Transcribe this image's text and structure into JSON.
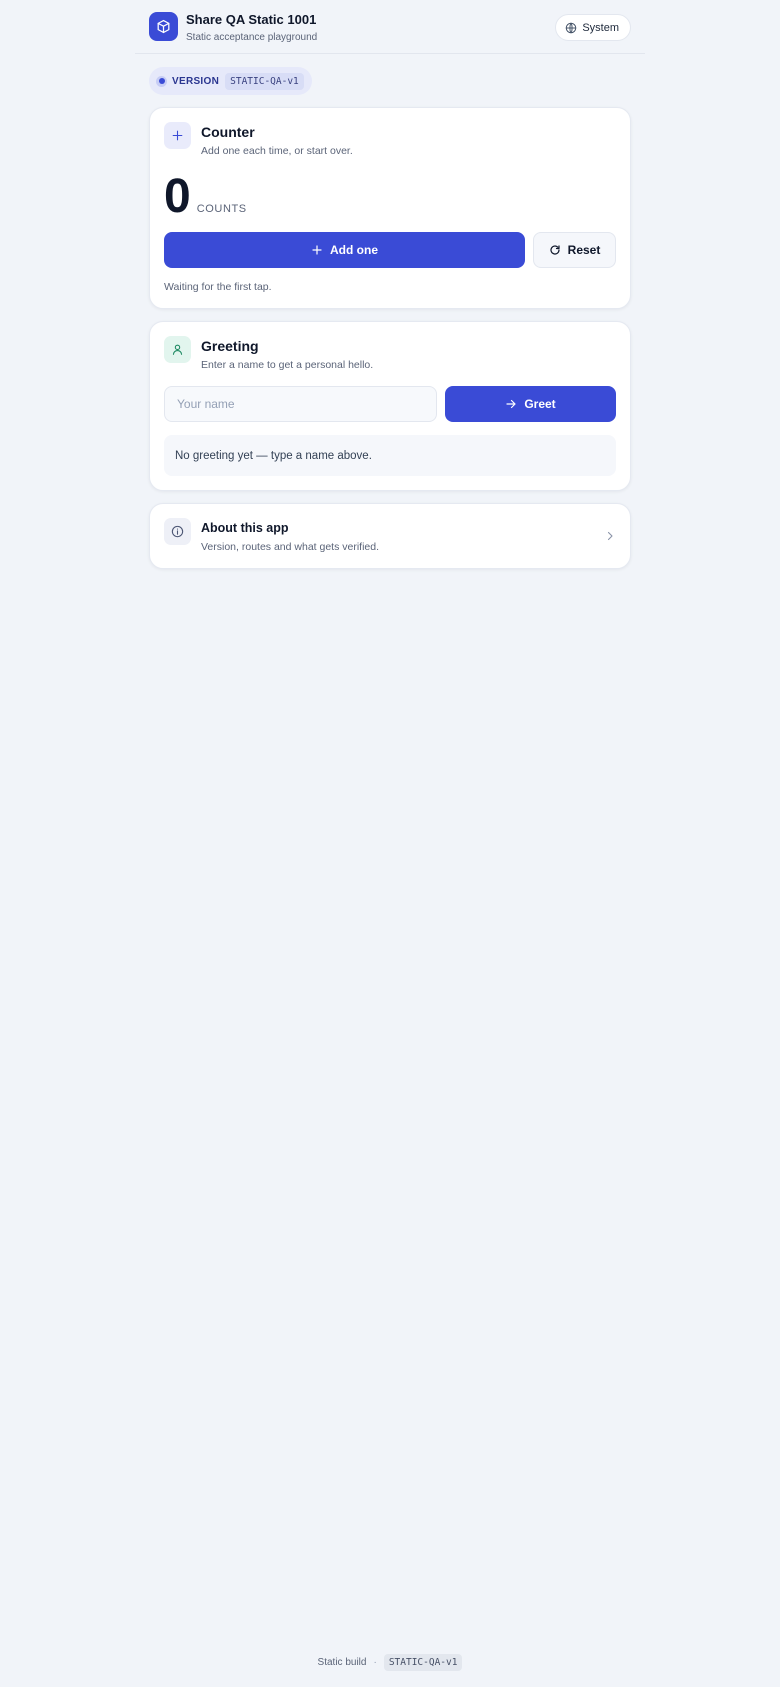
{
  "header": {
    "title": "Share QA Static 1001",
    "subtitle": "Static acceptance playground",
    "theme_button": "System",
    "brand_icon": "cube-icon",
    "theme_icon": "globe-icon"
  },
  "version": {
    "label": "VERSION",
    "code": "STATIC-QA-v1"
  },
  "counter": {
    "title": "Counter",
    "description": "Add one each time, or start over.",
    "value": "0",
    "unit": "COUNTS",
    "add_label": "Add one",
    "reset_label": "Reset",
    "status": "Waiting for the first tap."
  },
  "greeting": {
    "title": "Greeting",
    "description": "Enter a name to get a personal hello.",
    "input_placeholder": "Your name",
    "input_value": "",
    "greet_label": "Greet",
    "output": "No greeting yet — type a name above."
  },
  "about": {
    "title": "About this app",
    "description": "Version, routes and what gets verified."
  },
  "footer": {
    "label": "Static build",
    "separator": "·",
    "code": "STATIC-QA-v1"
  },
  "colors": {
    "accent": "#3a4bd6",
    "background": "#f1f4f9",
    "card": "#ffffff",
    "text": "#0f172a",
    "muted": "#5b6478"
  }
}
